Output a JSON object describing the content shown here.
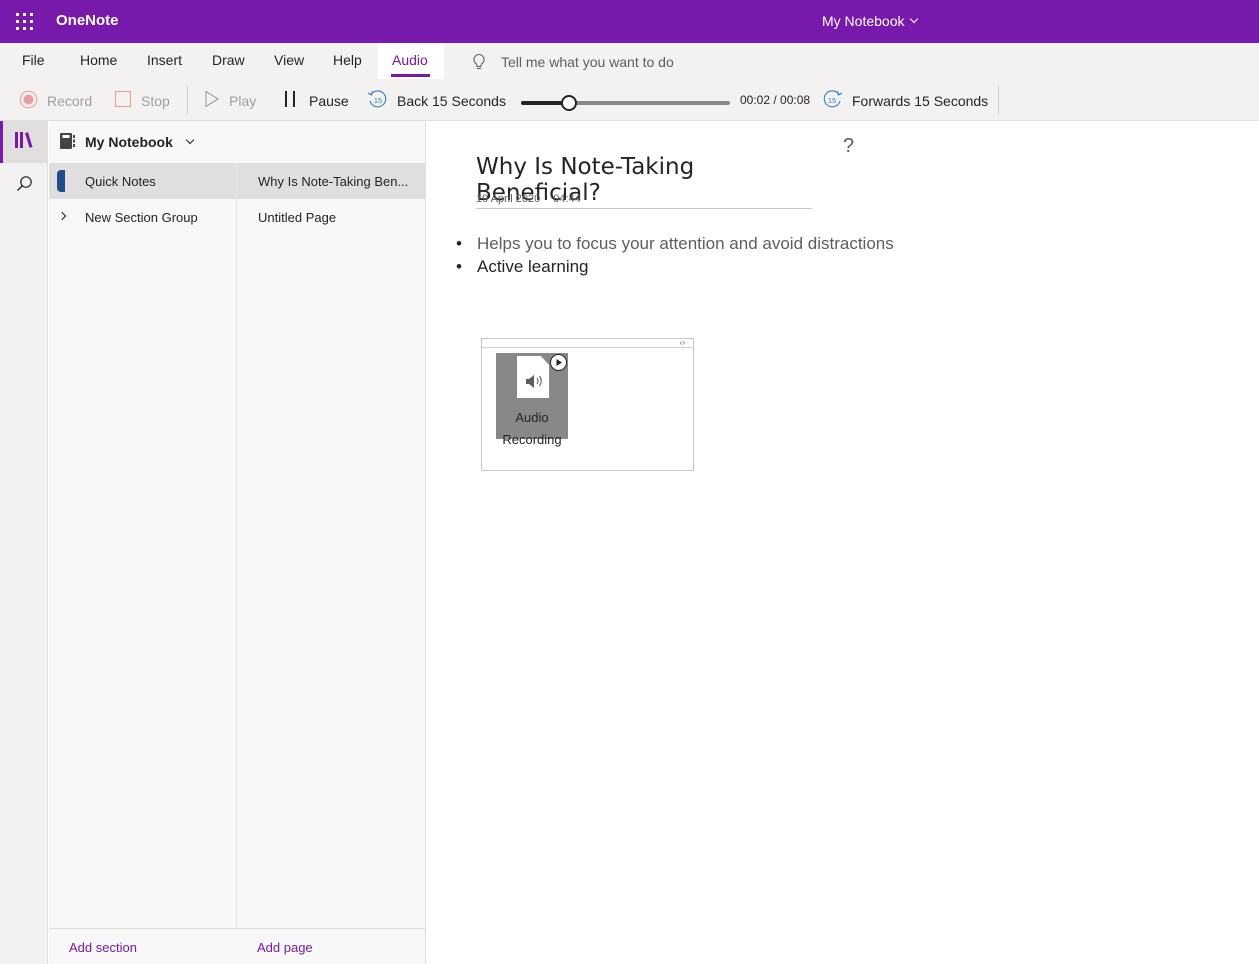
{
  "titlebar": {
    "app_name": "OneNote",
    "notebook_switcher": "My Notebook",
    "accent": "#7719aa"
  },
  "ribbon": {
    "tabs": [
      {
        "label": "File"
      },
      {
        "label": "Home"
      },
      {
        "label": "Insert"
      },
      {
        "label": "Draw"
      },
      {
        "label": "View"
      },
      {
        "label": "Help"
      },
      {
        "label": "Audio",
        "active": true
      }
    ],
    "tell_me_placeholder": "Tell me what you want to do"
  },
  "audio_toolbar": {
    "record_label": "Record",
    "stop_label": "Stop",
    "play_label": "Play",
    "pause_label": "Pause",
    "back_label": "Back 15 Seconds",
    "forward_label": "Forwards 15 Seconds",
    "skip_seconds": "15",
    "time_readout": "00:02 / 00:08",
    "progress_fraction": 0.23
  },
  "rail": {
    "items": [
      {
        "icon": "notebooks-icon",
        "active": true
      },
      {
        "icon": "search-icon",
        "active": false
      }
    ]
  },
  "navigation": {
    "notebook_name": "My Notebook",
    "sections": [
      {
        "label": "Quick Notes",
        "selected": true,
        "color": "#1f4e8c"
      },
      {
        "label": "New Section Group",
        "selected": false,
        "group": true
      }
    ],
    "pages": [
      {
        "label": "Why Is Note-Taking Ben...",
        "selected": true
      },
      {
        "label": "Untitled Page",
        "selected": false
      }
    ],
    "add_section": "Add section",
    "add_page": "Add page"
  },
  "page": {
    "help_glyph": "?",
    "title": "Why Is Note-Taking Beneficial?",
    "date": "19 April 2020",
    "time": "04:44",
    "bullets": [
      "Helps you to focus your attention and avoid distractions",
      "Active learning"
    ],
    "audio_embed": {
      "label_line1": "Audio",
      "label_line2": "Recording",
      "handle_glyph": "‹›"
    }
  }
}
